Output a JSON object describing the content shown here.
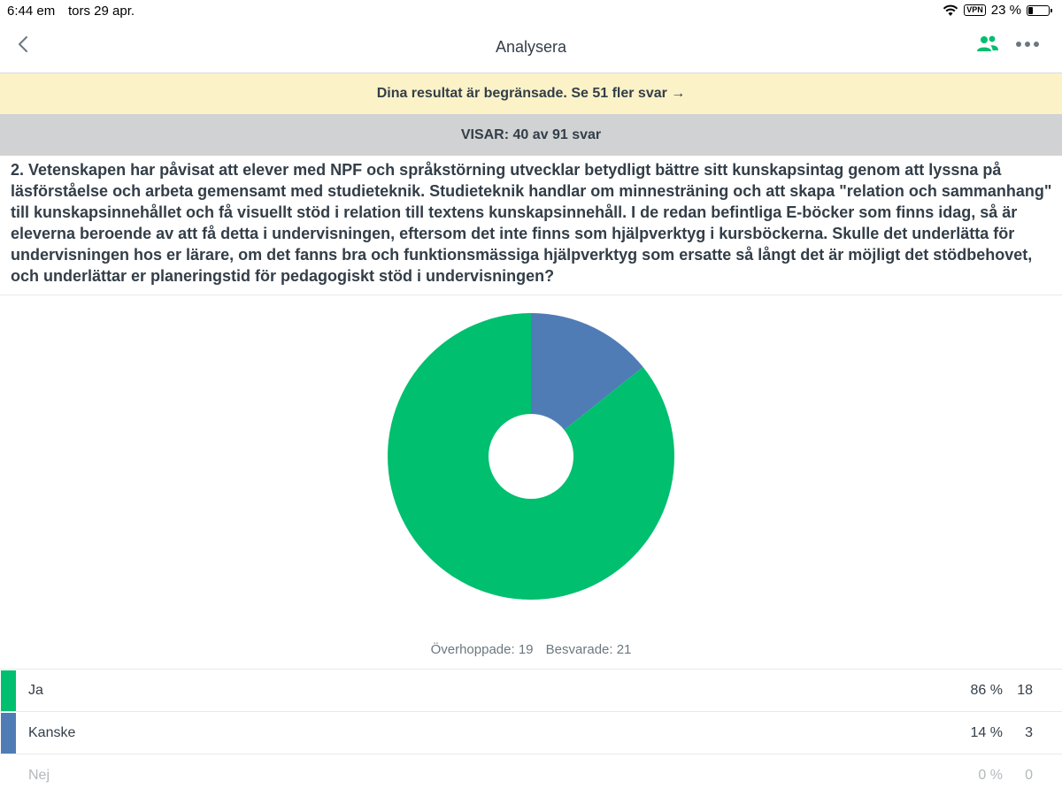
{
  "status_bar": {
    "time": "6:44 em",
    "date": "tors 29 apr.",
    "vpn": "VPN",
    "battery": "23 %",
    "battery_level": 0.23
  },
  "nav": {
    "title": "Analysera",
    "icons": [
      "chevron-left-icon",
      "users-icon",
      "more-icon"
    ]
  },
  "banner": {
    "text": "Dina resultat är begränsade. Se 51 fler svar →"
  },
  "showing": {
    "text": "VISAR: 40 av 91 svar"
  },
  "question": {
    "text": "2. Vetenskapen har påvisat att elever med NPF och språkstörning utvecklar betydligt bättre sitt kunskapsintag genom att lyssna på läsförståelse och arbeta gemensamt med studieteknik. Studieteknik handlar om minnesträning och att skapa \"relation och sammanhang\" till kunskapsinnehållet och få visuellt stöd i relation till textens kunskapsinnehåll. I de redan befintliga E-böcker som finns idag, så är eleverna beroende av att få detta i undervisningen, eftersom det inte finns som hjälpverktyg i kursböckerna. Skulle det underlätta för undervisningen hos er lärare, om det fanns bra och funktionsmässiga hjälpverktyg som ersatte så långt det är möjligt det stödbehovet, och underlättar er planeringstid för pedagogiskt stöd i undervisningen?"
  },
  "stats": {
    "skipped": "Överhoppade: 19",
    "answered": "Besvarade: 21"
  },
  "answers": [
    {
      "label": "Ja",
      "pct": "86 %",
      "count": "18"
    },
    {
      "label": "Kanske",
      "pct": "14 %",
      "count": "3"
    },
    {
      "label": "Nej",
      "pct": "0 %",
      "count": "0"
    }
  ],
  "colors": {
    "green": "#00bf6f",
    "blue": "#507cb6",
    "banner": "#fcf2c8",
    "gray_bar": "#d0d2d3"
  },
  "chart_data": {
    "type": "pie",
    "categories": [
      "Ja",
      "Kanske",
      "Nej"
    ],
    "values": [
      18,
      3,
      0
    ],
    "colors": [
      "#00bf6f",
      "#507cb6",
      "#d0d2d3"
    ],
    "donut": true
  }
}
